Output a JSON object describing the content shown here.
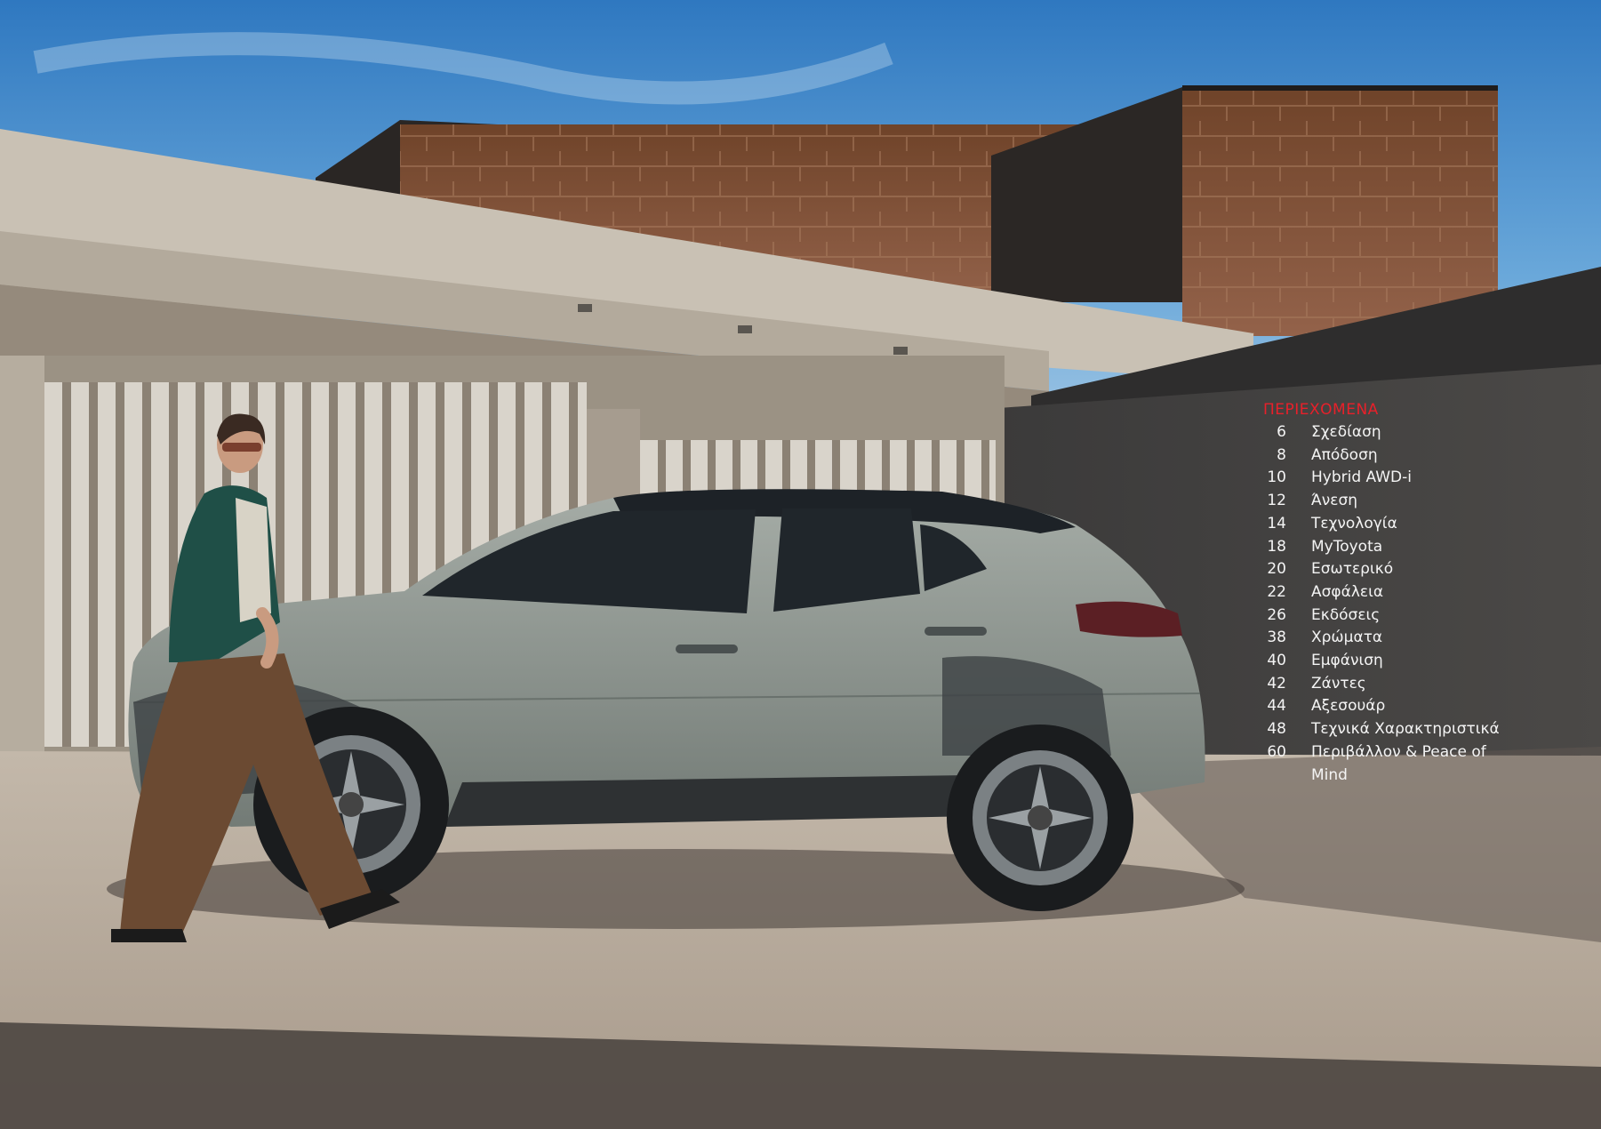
{
  "toc": {
    "heading": "ΠΕΡΙΕΧΟΜΕΝΑ",
    "heading_color": "#e8202a",
    "entries": [
      {
        "page": "6",
        "label": "Σχεδίαση"
      },
      {
        "page": "8",
        "label": "Απόδοση"
      },
      {
        "page": "10",
        "label": "Hybrid AWD-i"
      },
      {
        "page": "12",
        "label": "Άνεση"
      },
      {
        "page": "14",
        "label": "Τεχνολογία"
      },
      {
        "page": "18",
        "label": "MyToyota"
      },
      {
        "page": "20",
        "label": "Εσωτερικό"
      },
      {
        "page": "22",
        "label": "Ασφάλεια"
      },
      {
        "page": "26",
        "label": "Εκδόσεις"
      },
      {
        "page": "38",
        "label": "Χρώματα"
      },
      {
        "page": "40",
        "label": "Εμφάνιση"
      },
      {
        "page": "42",
        "label": "Ζάντες"
      },
      {
        "page": "44",
        "label": "Αξεσουάρ"
      },
      {
        "page": "48",
        "label": "Τεχνικά Χαρακτηριστικά"
      },
      {
        "page": "60",
        "label": "Περιβάλλον & Peace of Mind"
      }
    ]
  },
  "photo": {
    "description_icon": "hero-photo-car-and-woman",
    "colors": {
      "sky": "#4f93cf",
      "copper": "#7a4e35",
      "concrete": "#b9b1a3",
      "car_body": "#8e9791",
      "ground": "#b3a79a",
      "shadow": "#4a4440"
    }
  }
}
